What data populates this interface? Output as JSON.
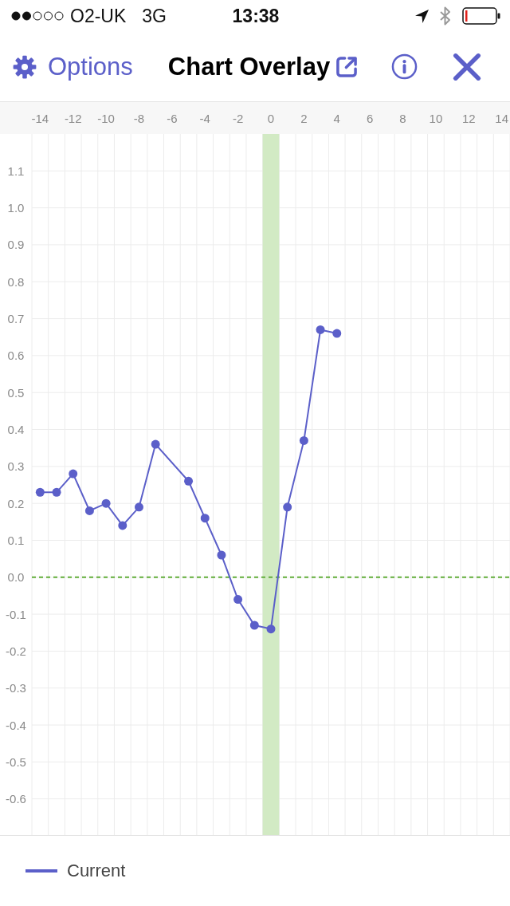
{
  "status_bar": {
    "carrier": "O2-UK",
    "network": "3G",
    "time": "13:38"
  },
  "header": {
    "options": "Options",
    "title": "Chart Overlay"
  },
  "chart": {
    "chart_data": {
      "type": "line",
      "x": [
        -14,
        -13,
        -12,
        -11,
        -10,
        -9,
        -8,
        -7,
        -5,
        -4,
        -3,
        -2,
        -1,
        0,
        1,
        2,
        3,
        4
      ],
      "series": [
        {
          "name": "Current",
          "color": "#5b5fc9",
          "marker": "circle",
          "values": [
            0.23,
            0.23,
            0.28,
            0.18,
            0.2,
            0.14,
            0.19,
            0.36,
            0.26,
            0.16,
            0.06,
            -0.06,
            -0.13,
            -0.14,
            0.19,
            0.37,
            0.67,
            0.66
          ]
        }
      ],
      "xlim": [
        -14.5,
        14.5
      ],
      "ylim": [
        -0.7,
        1.2
      ],
      "xticks": [
        -14,
        -12,
        -10,
        -8,
        -6,
        -4,
        -2,
        0,
        2,
        4,
        6,
        8,
        10,
        12,
        14
      ],
      "yticks": [
        1.1,
        {
          "value": 1,
          "label": "1.0"
        },
        0.9,
        0.8,
        0.7,
        0.6,
        0.5,
        0.4,
        0.3,
        0.2,
        0.1,
        {
          "value": 0,
          "label": "0.0"
        },
        -0.1,
        -0.2,
        -0.3,
        -0.4,
        -0.5,
        -0.6
      ],
      "grid": true,
      "bands": [
        {
          "axis": "x",
          "from": -0.5,
          "to": 0.5
        }
      ],
      "ref_lines": [
        {
          "axis": "y",
          "value": 0
        }
      ]
    }
  }
}
